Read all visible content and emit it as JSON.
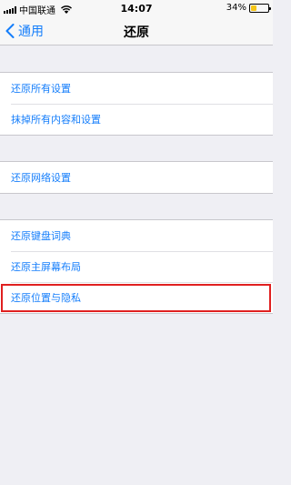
{
  "status_bar": {
    "carrier": "中国联通",
    "time": "14:07",
    "battery_percent": "34%",
    "battery_level": 0.34,
    "battery_color": "#f5c518"
  },
  "nav": {
    "back_label": "通用",
    "title": "还原"
  },
  "groups": [
    {
      "items": [
        "还原所有设置",
        "抹掉所有内容和设置"
      ]
    },
    {
      "items": [
        "还原网络设置"
      ]
    },
    {
      "items": [
        "还原键盘词典",
        "还原主屏幕布局",
        "还原位置与隐私"
      ]
    }
  ],
  "icons": {
    "back": "chevron-left-icon",
    "wifi": "wifi-icon",
    "signal": "signal-icon",
    "battery": "battery-icon"
  },
  "colors": {
    "accent": "#157efb",
    "highlight": "#e02020",
    "background": "#efeff4"
  }
}
